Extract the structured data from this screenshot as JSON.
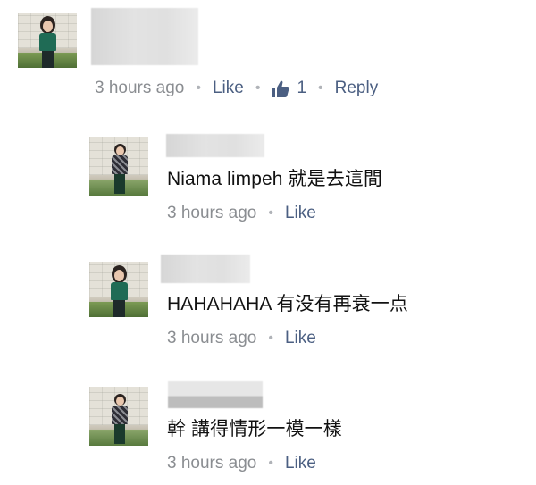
{
  "colors": {
    "text": "#111111",
    "meta_text": "#8a8d91",
    "action_link": "#4b5f82",
    "background": "#ffffff"
  },
  "comments": [
    {
      "avatar_icon": "profile-photo-woman-icon",
      "text": "",
      "timestamp": "3 hours ago",
      "like_label": "Like",
      "like_count": "1",
      "reply_label": "Reply"
    },
    {
      "avatar_icon": "profile-photo-man-icon",
      "text": "Niama limpeh 就是去這間",
      "timestamp": "3 hours ago",
      "like_label": "Like"
    },
    {
      "avatar_icon": "profile-photo-woman-icon",
      "text": "HAHAHAHA 有没有再衰一点",
      "timestamp": "3 hours ago",
      "like_label": "Like"
    },
    {
      "avatar_icon": "profile-photo-man-icon",
      "text": "幹 講得情形一模一樣",
      "timestamp": "3 hours ago",
      "like_label": "Like"
    }
  ]
}
